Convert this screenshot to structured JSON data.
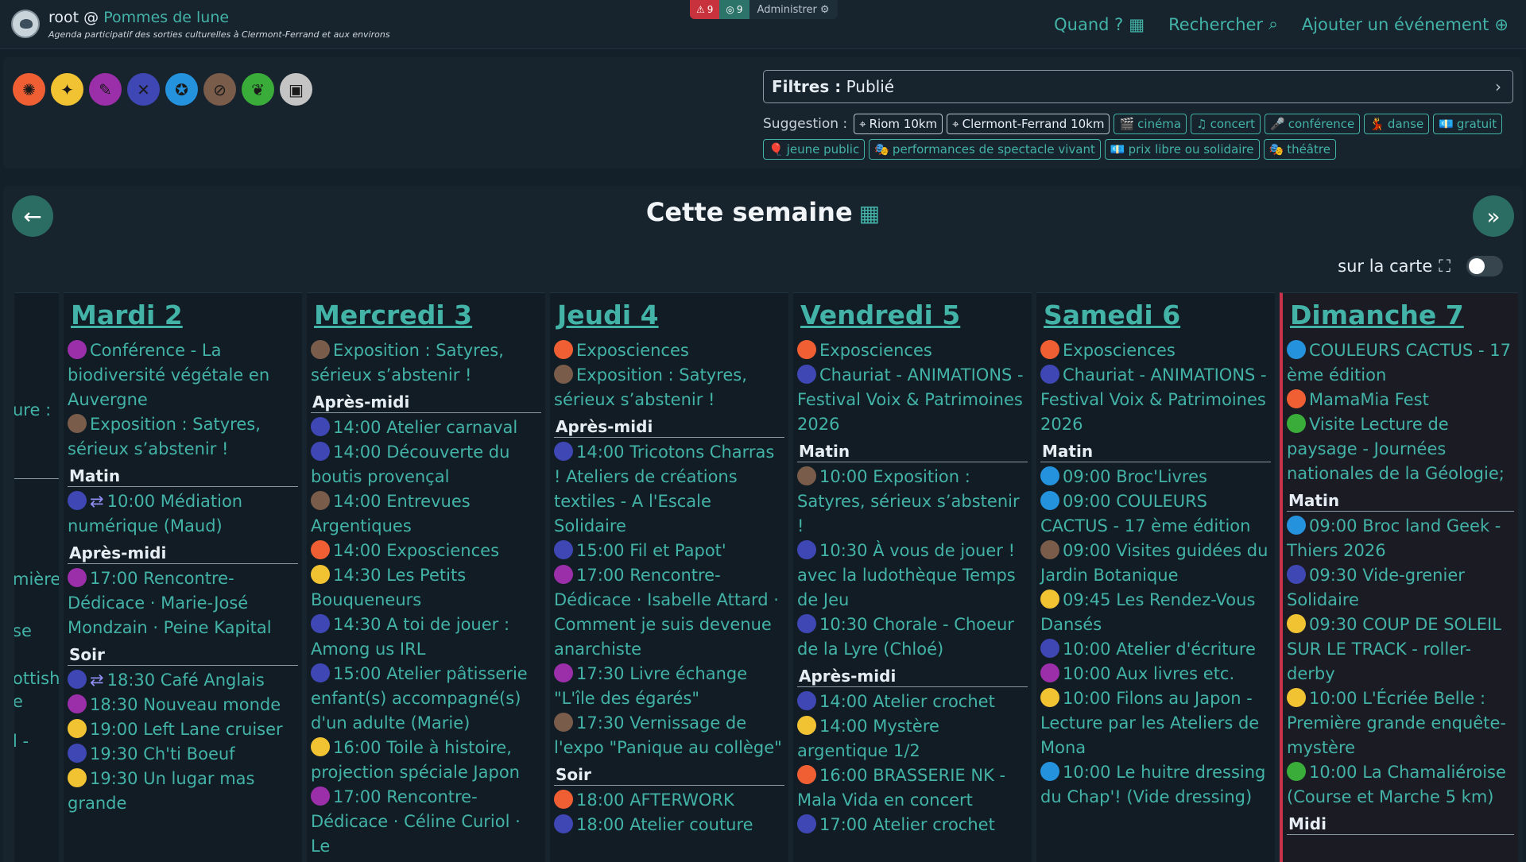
{
  "header": {
    "user": "root @",
    "site": "Pommes de lune",
    "tagline": "Agenda participatif des sorties culturelles à Clermont-Ferrand et aux environs",
    "alerts": "9",
    "moderation": "9",
    "admin": "Administrer",
    "nav": [
      {
        "label": "Quand ?",
        "icon": "calendar-icon"
      },
      {
        "label": "Rechercher",
        "icon": "search-icon"
      },
      {
        "label": "Ajouter un événement",
        "icon": "plus-circle-icon"
      }
    ]
  },
  "categories": [
    {
      "name": "fete",
      "color": "#f05f33",
      "glyph": "✺"
    },
    {
      "name": "spectacle",
      "color": "#f1c232",
      "glyph": "✦"
    },
    {
      "name": "rencontre",
      "color": "#9b2faa",
      "glyph": "✎"
    },
    {
      "name": "atelier",
      "color": "#3f47b5",
      "glyph": "✕"
    },
    {
      "name": "sortie",
      "color": "#2592dd",
      "glyph": "✪"
    },
    {
      "name": "exposition",
      "color": "#7a5c4a",
      "glyph": "⊘"
    },
    {
      "name": "nature",
      "color": "#3aac3a",
      "glyph": "❦"
    },
    {
      "name": "autre",
      "color": "#c4c4c4",
      "glyph": "▣"
    }
  ],
  "filters": {
    "label": "Filtres :",
    "value": "Publié",
    "suggestion_label": "Suggestion :",
    "chips": [
      {
        "label": "Riom 10km",
        "icon": "⌖",
        "dark": true
      },
      {
        "label": "Clermont-Ferrand 10km",
        "icon": "⌖",
        "dark": true
      },
      {
        "label": "cinéma",
        "icon": "🎬"
      },
      {
        "label": "concert",
        "icon": "♫"
      },
      {
        "label": "conférence",
        "icon": "🎤"
      },
      {
        "label": "danse",
        "icon": "💃"
      },
      {
        "label": "gratuit",
        "icon": "💶"
      },
      {
        "label": "jeune public",
        "icon": "🎈"
      },
      {
        "label": "performances de spectacle vivant",
        "icon": "🎭"
      },
      {
        "label": "prix libre ou solidaire",
        "icon": "💶"
      },
      {
        "label": "théâtre",
        "icon": "🎭"
      }
    ]
  },
  "agenda": {
    "title": "Cette semaine",
    "map_label": "sur la carte",
    "stub_lines": [
      "ure :",
      "",
      "",
      "mière",
      "se",
      "ottish",
      "e",
      "l -"
    ],
    "days": [
      {
        "name": "Mardi 2",
        "today": false,
        "items": [
          {
            "t": "ev",
            "c": "c3",
            "text": "Conférence - La biodiversité végétale en Auvergne"
          },
          {
            "t": "ev",
            "c": "c6",
            "text": "Exposition : Satyres, sérieux s’abstenir !"
          },
          {
            "t": "sec",
            "text": "Matin"
          },
          {
            "t": "ev",
            "c": "c4",
            "rep": true,
            "text": "10:00 Médiation numérique (Maud)"
          },
          {
            "t": "sec",
            "text": "Après-midi"
          },
          {
            "t": "ev",
            "c": "c3",
            "text": "17:00 Rencontre-Dédicace · Marie-José Mondzain · Peine Kapital"
          },
          {
            "t": "sec",
            "text": "Soir"
          },
          {
            "t": "ev",
            "c": "c4",
            "rep": true,
            "text": "18:30 Café Anglais"
          },
          {
            "t": "ev",
            "c": "c3",
            "text": "18:30 Nouveau monde"
          },
          {
            "t": "ev",
            "c": "c2",
            "text": "19:00 Left Lane cruiser"
          },
          {
            "t": "ev",
            "c": "c4",
            "text": "19:30 Ch'ti Boeuf"
          },
          {
            "t": "ev",
            "c": "c2",
            "text": "19:30 Un lugar mas grande"
          }
        ]
      },
      {
        "name": "Mercredi 3",
        "today": false,
        "items": [
          {
            "t": "ev",
            "c": "c6",
            "text": "Exposition : Satyres, sérieux s’abstenir !"
          },
          {
            "t": "sec",
            "text": "Après-midi"
          },
          {
            "t": "ev",
            "c": "c4",
            "text": "14:00 Atelier carnaval"
          },
          {
            "t": "ev",
            "c": "c4",
            "text": "14:00 Découverte du boutis provençal"
          },
          {
            "t": "ev",
            "c": "c6",
            "text": "14:00 Entrevues Argentiques"
          },
          {
            "t": "ev",
            "c": "c1",
            "text": "14:00 Exposciences"
          },
          {
            "t": "ev",
            "c": "c2",
            "text": "14:30 Les Petits Bouqueneurs"
          },
          {
            "t": "ev",
            "c": "c4",
            "text": "14:30 A toi de jouer : Among us IRL"
          },
          {
            "t": "ev",
            "c": "c4",
            "text": "15:00 Atelier pâtisserie enfant(s) accompagné(s) d'un adulte (Marie)"
          },
          {
            "t": "ev",
            "c": "c2",
            "text": "16:00 Toile à histoire, projection spéciale Japon"
          },
          {
            "t": "ev",
            "c": "c3",
            "text": "17:00 Rencontre-Dédicace · Céline Curiol · Le"
          }
        ]
      },
      {
        "name": "Jeudi 4",
        "today": false,
        "items": [
          {
            "t": "ev",
            "c": "c1",
            "text": "Exposciences"
          },
          {
            "t": "ev",
            "c": "c6",
            "text": "Exposition : Satyres, sérieux s’abstenir !"
          },
          {
            "t": "sec",
            "text": "Après-midi"
          },
          {
            "t": "ev",
            "c": "c4",
            "text": "14:00 Tricotons Charras ! Ateliers de créations textiles - A l'Escale Solidaire"
          },
          {
            "t": "ev",
            "c": "c4",
            "text": "15:00 Fil et Papot'"
          },
          {
            "t": "ev",
            "c": "c3",
            "text": "17:00 Rencontre-Dédicace · Isabelle Attard · Comment je suis devenue anarchiste"
          },
          {
            "t": "ev",
            "c": "c3",
            "text": "17:30 Livre échange \"L'île des égarés\""
          },
          {
            "t": "ev",
            "c": "c6",
            "text": "17:30 Vernissage de l'expo \"Panique au collège\""
          },
          {
            "t": "sec",
            "text": "Soir"
          },
          {
            "t": "ev",
            "c": "c1",
            "text": "18:00 AFTERWORK"
          },
          {
            "t": "ev",
            "c": "c4",
            "text": "18:00 Atelier couture"
          }
        ]
      },
      {
        "name": "Vendredi 5",
        "today": false,
        "items": [
          {
            "t": "ev",
            "c": "c1",
            "text": "Exposciences"
          },
          {
            "t": "ev",
            "c": "c4",
            "text": "Chauriat - ANIMATIONS - Festival Voix & Patrimoines 2026"
          },
          {
            "t": "sec",
            "text": "Matin"
          },
          {
            "t": "ev",
            "c": "c6",
            "text": "10:00 Exposition : Satyres, sérieux s’abstenir !"
          },
          {
            "t": "ev",
            "c": "c4",
            "text": "10:30 À vous de jouer ! avec la ludothèque Temps de Jeu"
          },
          {
            "t": "ev",
            "c": "c4",
            "text": "10:30 Chorale - Choeur de la Lyre (Chloé)"
          },
          {
            "t": "sec",
            "text": "Après-midi"
          },
          {
            "t": "ev",
            "c": "c4",
            "text": "14:00 Atelier crochet"
          },
          {
            "t": "ev",
            "c": "c2",
            "text": "14:00 Mystère argentique 1/2"
          },
          {
            "t": "ev",
            "c": "c1",
            "text": "16:00 BRASSERIE NK - Mala Vida en concert"
          },
          {
            "t": "ev",
            "c": "c4",
            "text": "17:00 Atelier crochet"
          }
        ]
      },
      {
        "name": "Samedi 6",
        "today": false,
        "items": [
          {
            "t": "ev",
            "c": "c1",
            "text": "Exposciences"
          },
          {
            "t": "ev",
            "c": "c4",
            "text": "Chauriat - ANIMATIONS - Festival Voix & Patrimoines 2026"
          },
          {
            "t": "sec",
            "text": "Matin"
          },
          {
            "t": "ev",
            "c": "c5",
            "text": "09:00 Broc'Livres"
          },
          {
            "t": "ev",
            "c": "c5",
            "text": "09:00 COULEURS CACTUS - 17 ème édition"
          },
          {
            "t": "ev",
            "c": "c6",
            "text": "09:00 Visites guidées du Jardin Botanique"
          },
          {
            "t": "ev",
            "c": "c2",
            "text": "09:45 Les Rendez-Vous Dansés"
          },
          {
            "t": "ev",
            "c": "c4",
            "text": "10:00 Atelier d'écriture"
          },
          {
            "t": "ev",
            "c": "c3",
            "text": "10:00 Aux livres etc."
          },
          {
            "t": "ev",
            "c": "c2",
            "text": "10:00 Filons au Japon - Lecture par les Ateliers de Mona"
          },
          {
            "t": "ev",
            "c": "c5",
            "text": "10:00 Le huitre dressing du Chap'! (Vide dressing)"
          }
        ]
      },
      {
        "name": "Dimanche 7",
        "today": true,
        "items": [
          {
            "t": "ev",
            "c": "c5",
            "text": "COULEURS CACTUS - 17 ème édition"
          },
          {
            "t": "ev",
            "c": "c1",
            "text": "MamaMia Fest"
          },
          {
            "t": "ev",
            "c": "c7",
            "text": "Visite Lecture de paysage - Journées nationales de la Géologie;"
          },
          {
            "t": "sec",
            "text": "Matin"
          },
          {
            "t": "ev",
            "c": "c5",
            "text": "09:00 Broc land Geek - Thiers 2026"
          },
          {
            "t": "ev",
            "c": "c4",
            "text": "09:30 Vide-grenier Solidaire"
          },
          {
            "t": "ev",
            "c": "c2",
            "text": "09:30 COUP DE SOLEIL SUR LE TRACK - roller-derby"
          },
          {
            "t": "ev",
            "c": "c2",
            "text": "10:00 L'Écriée Belle : Première grande enquête-mystère"
          },
          {
            "t": "ev",
            "c": "c7",
            "text": "10:00 La Chamaliéroise (Course et Marche 5 km)"
          },
          {
            "t": "sec",
            "text": "Midi"
          }
        ]
      }
    ]
  }
}
